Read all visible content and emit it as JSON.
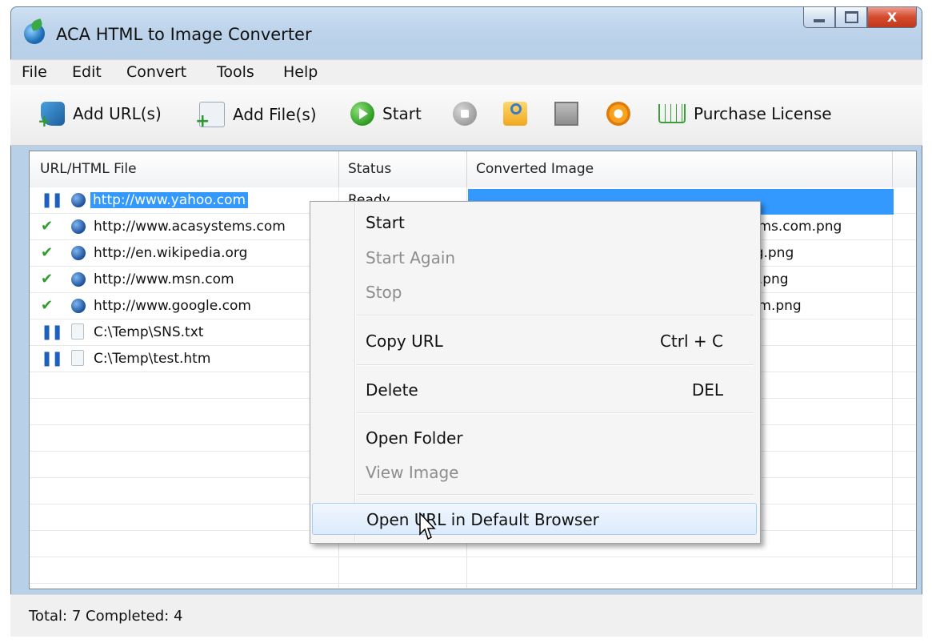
{
  "window": {
    "title": "ACA HTML to Image Converter",
    "icon": "globe-leaf-icon",
    "controls": {
      "minimize": "minimize-icon",
      "maximize": "maximize-icon",
      "close": "X"
    }
  },
  "menu": [
    "File",
    "Edit",
    "Convert",
    "Tools",
    "Help"
  ],
  "toolbar": {
    "add_url": "Add URL(s)",
    "add_file": "Add File(s)",
    "start": "Start",
    "purchase": "Purchase License"
  },
  "list": {
    "columns": [
      "URL/HTML File",
      "Status",
      "Converted Image"
    ],
    "rows": [
      {
        "state": "pause",
        "kind": "url",
        "file": "http://www.yahoo.com",
        "status": "Ready",
        "image": ""
      },
      {
        "state": "done",
        "kind": "url",
        "file": "http://www.acasystems.com",
        "status": "",
        "image": "ems.com.png"
      },
      {
        "state": "done",
        "kind": "url",
        "file": "http://en.wikipedia.org",
        "status": "",
        "image": "rg.png"
      },
      {
        "state": "done",
        "kind": "url",
        "file": "http://www.msn.com",
        "status": "",
        "image": "1.png"
      },
      {
        "state": "done",
        "kind": "url",
        "file": "http://www.google.com",
        "status": "",
        "image": "om.png"
      },
      {
        "state": "pause",
        "kind": "file",
        "file": "C:\\Temp\\SNS.txt",
        "status": "",
        "image": ""
      },
      {
        "state": "pause",
        "kind": "file",
        "file": "C:\\Temp\\test.htm",
        "status": "",
        "image": ""
      }
    ]
  },
  "status_bar": "Total: 7 Completed: 4",
  "context_menu": {
    "items": [
      {
        "label": "Start",
        "shortcut": "",
        "enabled": true
      },
      {
        "label": "Start Again",
        "shortcut": "",
        "enabled": false
      },
      {
        "label": "Stop",
        "shortcut": "",
        "enabled": false
      },
      {
        "label": "Copy URL",
        "shortcut": "Ctrl + C",
        "enabled": true
      },
      {
        "label": "Delete",
        "shortcut": "DEL",
        "enabled": true
      },
      {
        "label": "Open Folder",
        "shortcut": "",
        "enabled": true
      },
      {
        "label": "View Image",
        "shortcut": "",
        "enabled": false
      },
      {
        "label": "Open URL in Default Browser",
        "shortcut": "",
        "enabled": true,
        "hovered": true
      }
    ]
  },
  "colors": {
    "selection": "#3399ff",
    "check": "#2f9e2f",
    "pause": "#1d5fbf"
  }
}
